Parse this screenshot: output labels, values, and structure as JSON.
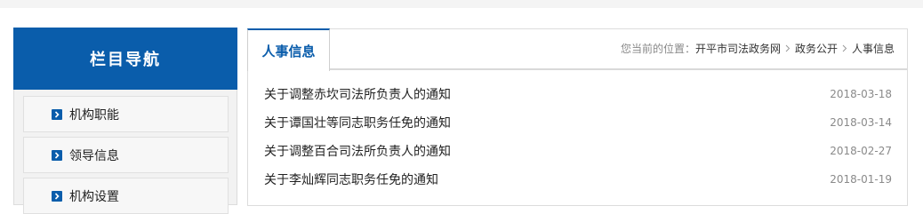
{
  "sidebar": {
    "title": "栏目导航",
    "items": [
      {
        "label": "机构职能"
      },
      {
        "label": "领导信息"
      },
      {
        "label": "机构设置"
      }
    ]
  },
  "main": {
    "tab_label": "人事信息",
    "breadcrumb": {
      "prefix": "您当前的位置：",
      "crumbs": [
        "开平市司法政务网",
        "政务公开",
        "人事信息"
      ]
    },
    "news": [
      {
        "title": "关于调整赤坎司法所负责人的通知",
        "date": "2018-03-18"
      },
      {
        "title": "关于谭国壮等同志职务任免的通知",
        "date": "2018-03-14"
      },
      {
        "title": "关于调整百合司法所负责人的通知",
        "date": "2018-02-27"
      },
      {
        "title": "关于李灿辉同志职务任免的通知",
        "date": "2018-01-19"
      }
    ]
  },
  "colors": {
    "brand_blue": "#0a5dab",
    "text": "#222222",
    "muted": "#8a8a8a"
  },
  "icons": {
    "nav_bullet": "chevron-right-icon",
    "breadcrumb_separator": "chevron-right-icon"
  }
}
